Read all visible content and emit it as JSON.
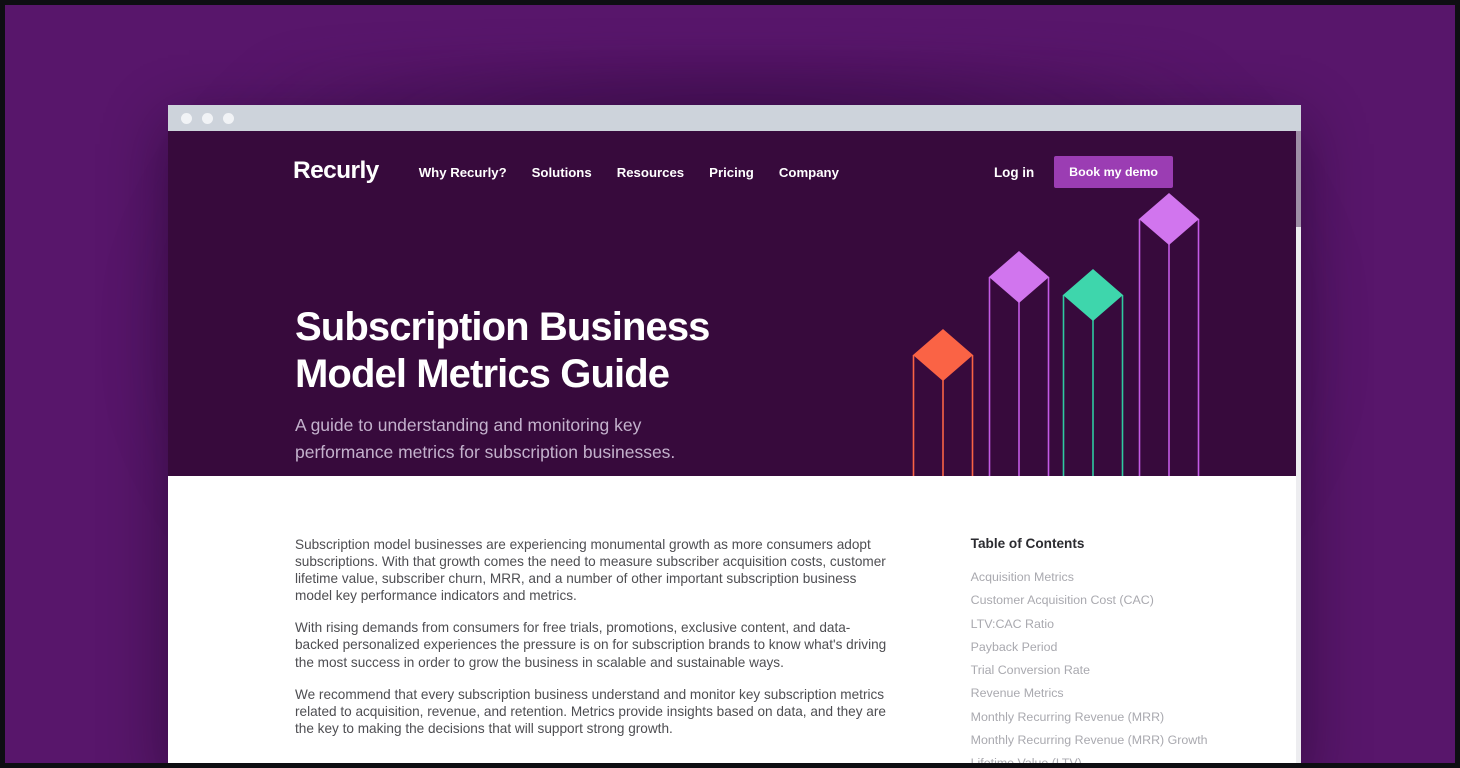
{
  "window": {
    "chrome_dots": [
      "close-dot",
      "minimize-dot",
      "maximize-dot"
    ]
  },
  "nav": {
    "logo": "Recurly",
    "links": [
      {
        "label": "Why Recurly?"
      },
      {
        "label": "Solutions"
      },
      {
        "label": "Resources"
      },
      {
        "label": "Pricing"
      },
      {
        "label": "Company"
      }
    ],
    "login_label": "Log in",
    "demo_label": "Book my demo"
  },
  "hero": {
    "title": "Subscription Business\nModel Metrics Guide",
    "subtitle": "A guide to understanding and monitoring key\nperformance metrics for subscription businesses."
  },
  "article": {
    "paragraphs": [
      "Subscription model businesses are experiencing monumental growth as more consumers adopt subscriptions. With that growth comes the need to measure subscriber acquisition costs, customer lifetime value, subscriber churn, MRR, and a number of other important subscription business model key performance indicators and metrics.",
      "With rising demands from consumers for free trials, promotions, exclusive content, and data-backed personalized experiences the pressure is on for subscription brands to know what's driving the most success in order to grow the business in scalable and sustainable ways.",
      "We recommend that every subscription business understand and monitor key subscription metrics related to acquisition, revenue, and retention. Metrics provide insights based on data, and they are the key to making the decisions that will support strong growth."
    ]
  },
  "toc": {
    "title": "Table of Contents",
    "items": [
      {
        "label": "Acquisition Metrics"
      },
      {
        "label": "Customer Acquisition Cost (CAC)"
      },
      {
        "label": "LTV:CAC Ratio"
      },
      {
        "label": "Payback Period"
      },
      {
        "label": "Trial Conversion Rate"
      },
      {
        "label": "Revenue Metrics"
      },
      {
        "label": "Monthly Recurring Revenue (MRR)"
      },
      {
        "label": "Monthly Recurring Revenue (MRR) Growth"
      },
      {
        "label": "Lifetime Value (LTV)"
      }
    ]
  },
  "theme": {
    "page_background": "#58166B",
    "hero_background": "#370A3C",
    "chrome_background": "#CDD3DB",
    "accent_button": "#9B3DB3",
    "bar_orange": "#FA6345",
    "bar_purple": "#D175EE",
    "bar_teal": "#3ED6AC",
    "subtitle_color": "#C3B1CC",
    "body_text": "#4E4E52",
    "toc_text": "#A9A9AF"
  },
  "chart_data": {
    "type": "bar",
    "title": "",
    "categories": [
      "bar-1",
      "bar-2",
      "bar-3",
      "bar-4"
    ],
    "values": [
      26,
      64,
      52,
      90
    ],
    "colors": [
      "#FA6345",
      "#D175EE",
      "#3ED6AC",
      "#D175EE"
    ],
    "style": "isometric-3d-columns",
    "xlabel": "",
    "ylabel": "",
    "grid": false,
    "legend": "none",
    "ylim": [
      0,
      100
    ]
  }
}
